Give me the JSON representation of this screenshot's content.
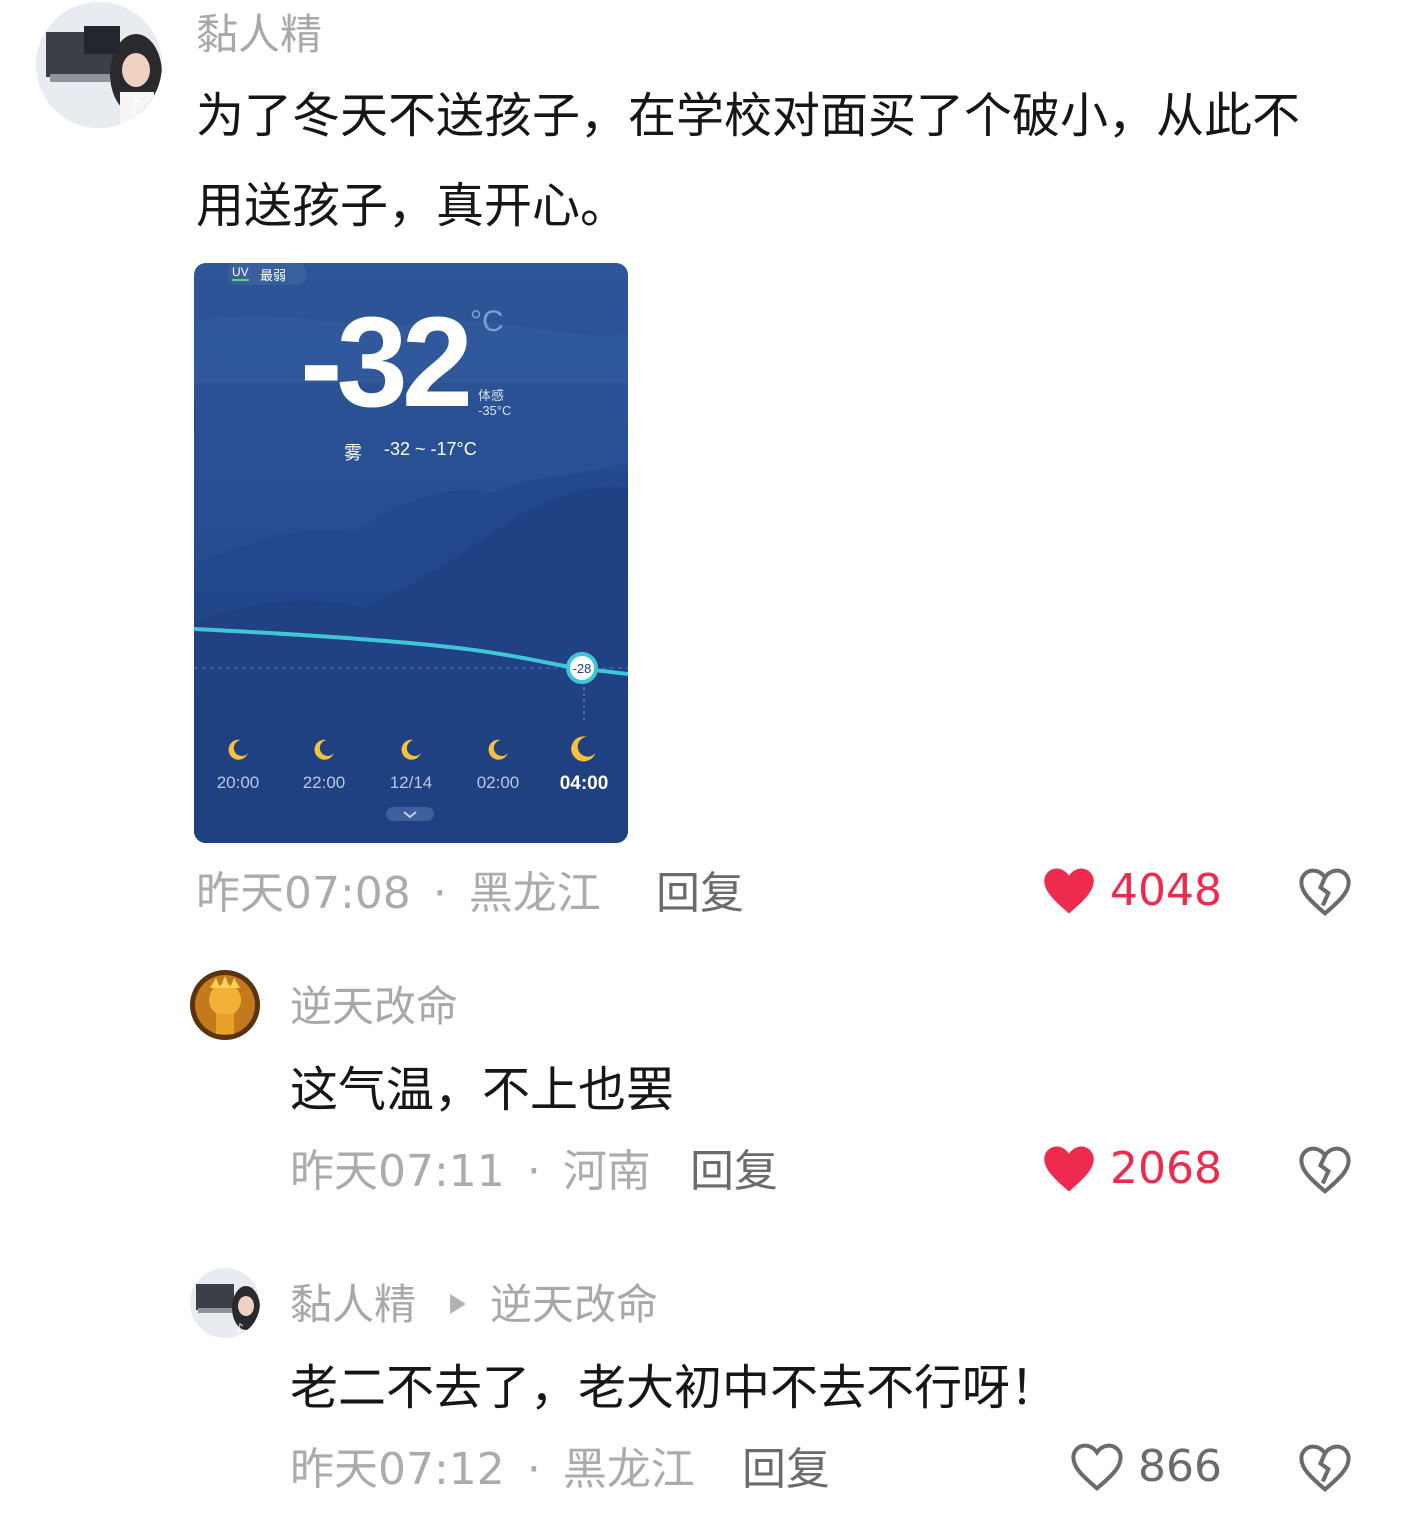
{
  "comments": [
    {
      "username": "黏人精",
      "content_lines": [
        "为了冬天不送孩子，在学校对面买了个破小，从此不",
        "用送孩子，真开心。"
      ],
      "time": "昨天07:08",
      "location": "黑龙江",
      "reply_label": "回复",
      "likes": "4048",
      "liked": true,
      "weather": {
        "uv_label": "UV",
        "uv_level": "最弱",
        "temperature": "-32",
        "unit": "°C",
        "feels_label": "体感",
        "feels_value": "-35°C",
        "condition": "雾",
        "range": "-32 ~ -17°C",
        "current_point": "-28",
        "times": [
          "20:00",
          "22:00",
          "12/14",
          "02:00",
          "04:00"
        ],
        "icon": "moon-icon"
      }
    },
    {
      "username": "逆天改命",
      "content": "这气温，不上也罢",
      "time": "昨天07:11",
      "location": "河南",
      "reply_label": "回复",
      "likes": "2068",
      "liked": true
    },
    {
      "username": "黏人精",
      "reply_to": "逆天改命",
      "content": "老二不去了，老大初中不去不行呀！",
      "time": "昨天07:12",
      "location": "黑龙江",
      "reply_label": "回复",
      "likes": "866",
      "liked": false
    }
  ],
  "separator": "·",
  "colors": {
    "liked": "#ef2a4f",
    "meta": "#ababab",
    "text": "#161616"
  }
}
